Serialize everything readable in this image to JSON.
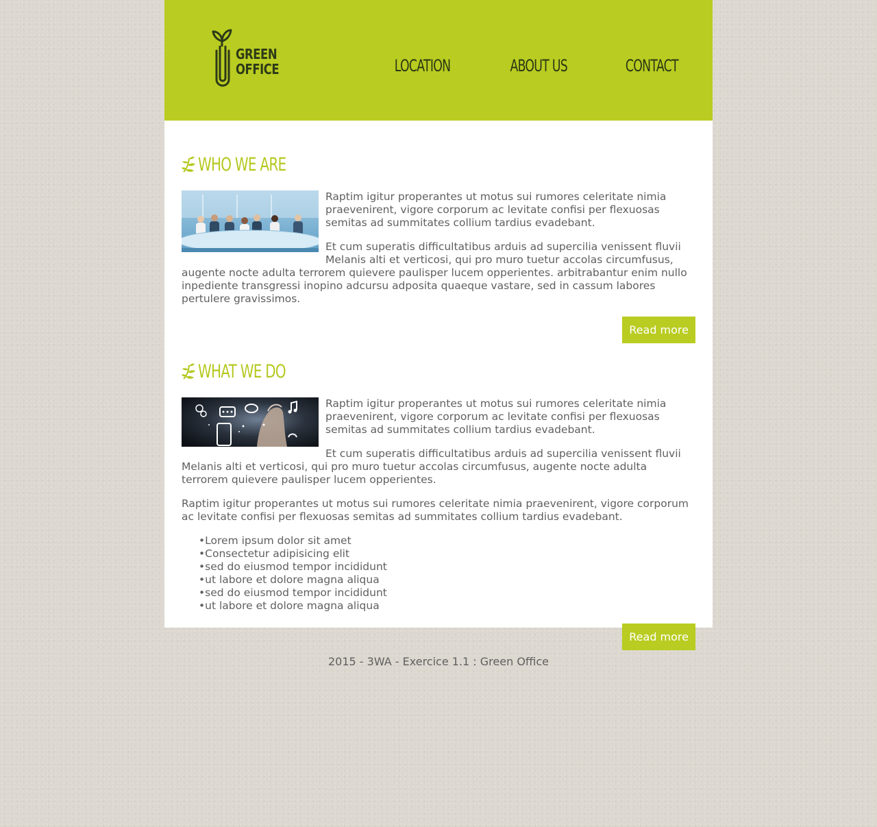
{
  "brand": {
    "line1": "GREEN",
    "line2": "OFFICE"
  },
  "nav": [
    {
      "label": "LOCATION"
    },
    {
      "label": "ABOUT US"
    },
    {
      "label": "CONTACT"
    }
  ],
  "sections": [
    {
      "title": "WHO WE ARE",
      "paragraphs": [
        "Raptim igitur properantes ut motus sui rumores celeritate nimia praevenirent, vigore corporum ac levitate confisi per flexuosas semitas ad summitates collium tardius evadebant.",
        "Et cum superatis difficultatibus arduis ad supercilia venissent fluvii Melanis alti et verticosi, qui pro muro tuetur accolas circumfusus, augente nocte adulta terrorem quievere paulisper lucem opperientes. arbitrabantur enim nullo inpediente transgressi inopino adcursu adposita quaeque vastare, sed in cassum labores pertulere gravissimos."
      ],
      "button": "Read more"
    },
    {
      "title": "WHAT WE DO",
      "paragraphs": [
        "Raptim igitur properantes ut motus sui rumores celeritate nimia praevenirent, vigore corporum ac levitate confisi per flexuosas semitas ad summitates collium tardius evadebant.",
        "Et cum superatis difficultatibus arduis ad supercilia venissent fluvii Melanis alti et verticosi, qui pro muro tuetur accolas circumfusus, augente nocte adulta terrorem quievere paulisper lucem opperientes.",
        "Raptim igitur properantes ut motus sui rumores celeritate nimia praevenirent, vigore corporum ac levitate confisi per flexuosas semitas ad summitates collium tardius evadebant."
      ],
      "list": [
        "Lorem ipsum dolor sit amet",
        "Consectetur adipisicing elit",
        "sed do eiusmod tempor incididunt",
        "ut labore et dolore magna aliqua",
        "sed do eiusmod tempor incididunt",
        "ut labore et dolore magna aliqua"
      ],
      "button": "Read more"
    }
  ],
  "footer": {
    "text": "2015 - 3WA - Exercice 1.1 : Green Office"
  },
  "icons": {
    "logo": "paperclip-sprout-icon",
    "heading": "leaf-icon"
  },
  "colors": {
    "accent": "#b9cc21",
    "dark": "#2a3614",
    "text": "#5f5f5f",
    "page_bg": "#dcd7cf"
  }
}
